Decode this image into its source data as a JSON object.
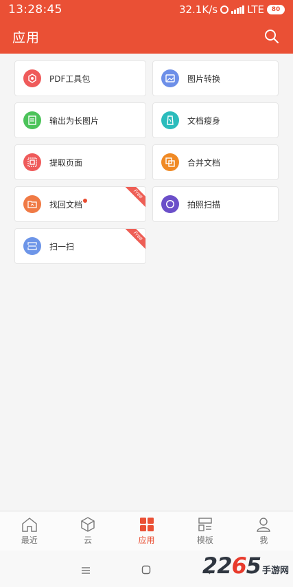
{
  "status": {
    "time": "13:28:45",
    "speed": "32.1K/s",
    "network": "LTE",
    "battery": "80"
  },
  "header": {
    "title": "应用"
  },
  "tools": [
    {
      "label": "PDF工具包",
      "color": "#ef5b5b",
      "icon": "pdf-icon",
      "badge": "",
      "dot": false
    },
    {
      "label": "图片转换",
      "color": "#6d8fe8",
      "icon": "image-icon",
      "badge": "",
      "dot": false
    },
    {
      "label": "输出为长图片",
      "color": "#4cc35a",
      "icon": "long-image-icon",
      "badge": "",
      "dot": false
    },
    {
      "label": "文档瘦身",
      "color": "#2bbcbc",
      "icon": "compress-icon",
      "badge": "",
      "dot": false
    },
    {
      "label": "提取页面",
      "color": "#ef5b5b",
      "icon": "extract-icon",
      "badge": "",
      "dot": false
    },
    {
      "label": "合并文档",
      "color": "#f08a25",
      "icon": "merge-icon",
      "badge": "",
      "dot": false
    },
    {
      "label": "找回文档",
      "color": "#f07a45",
      "icon": "recover-icon",
      "badge": "Free",
      "dot": true
    },
    {
      "label": "拍照扫描",
      "color": "#6b4fc9",
      "icon": "camera-scan-icon",
      "badge": "",
      "dot": false
    },
    {
      "label": "扫一扫",
      "color": "#6d95e8",
      "icon": "scan-icon",
      "badge": "Free",
      "dot": false
    }
  ],
  "nav": [
    {
      "label": "最近",
      "icon": "home-icon",
      "active": false
    },
    {
      "label": "云",
      "icon": "cloud-box-icon",
      "active": false
    },
    {
      "label": "应用",
      "icon": "apps-icon",
      "active": true
    },
    {
      "label": "模板",
      "icon": "template-icon",
      "active": false
    },
    {
      "label": "我",
      "icon": "user-icon",
      "active": false
    }
  ],
  "watermark": {
    "digits_a": "22",
    "digits_b": "6",
    "digits_c": "5",
    "site": "手游网"
  },
  "colors": {
    "accent": "#ea5035",
    "background": "#f5f5f5"
  }
}
